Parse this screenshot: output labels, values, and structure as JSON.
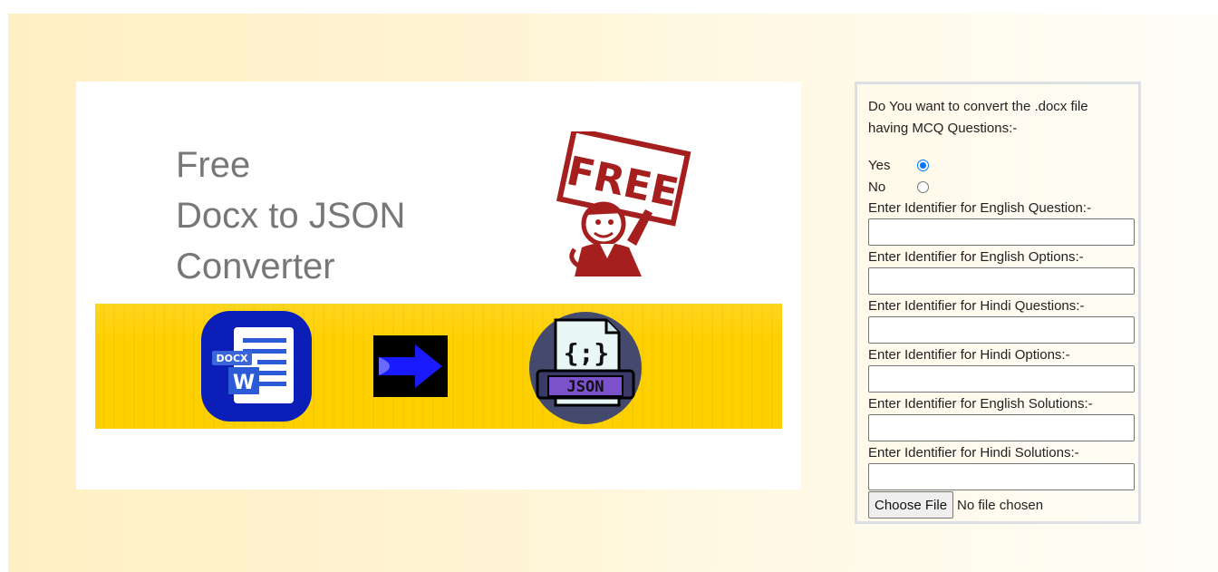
{
  "hero": {
    "title_lines": [
      "Free",
      "Docx to JSON",
      "Converter"
    ],
    "free_stamp_text": "FREE",
    "word_icon_label": "DOCX",
    "word_icon_letter": "W",
    "json_icon_braces": "{;}",
    "json_icon_label": "JSON"
  },
  "form": {
    "question": "Do You want to convert the .docx file having MCQ Questions:-",
    "radio_yes_label": "Yes",
    "radio_no_label": "No",
    "radio_selected": "Yes",
    "fields": [
      {
        "label": "Enter Identifier for English Question:-",
        "value": ""
      },
      {
        "label": "Enter Identifier for English Options:-",
        "value": ""
      },
      {
        "label": "Enter Identifier for Hindi Questions:-",
        "value": ""
      },
      {
        "label": "Enter Identifier for Hindi Options:-",
        "value": ""
      },
      {
        "label": "Enter Identifier for English Solutions:-",
        "value": ""
      },
      {
        "label": "Enter Identifier for Hindi Solutions:-",
        "value": ""
      }
    ],
    "file_button_label": "Choose File",
    "file_status": "No file chosen"
  },
  "colors": {
    "radio_accent": "#0075ff",
    "banner_yellow": "#ffd000",
    "stamp_red": "#a51f1f",
    "word_blue": "#1e40d8",
    "json_purple": "#4a4a7a"
  }
}
